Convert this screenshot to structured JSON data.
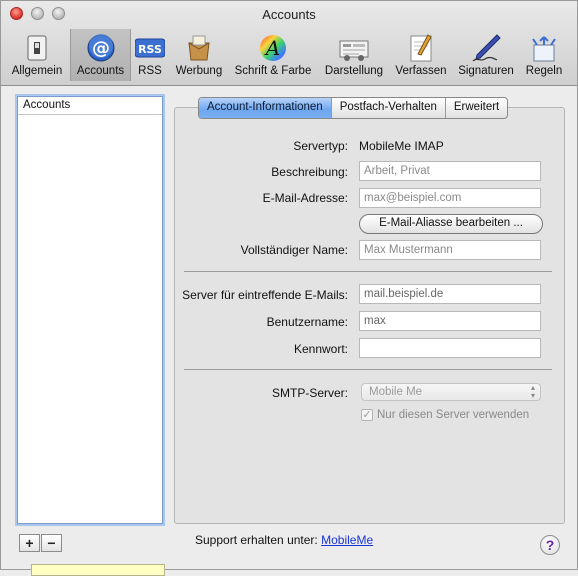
{
  "window": {
    "title": "Accounts"
  },
  "toolbar": {
    "items": [
      {
        "label": "Allgemein",
        "icon": "switch-icon"
      },
      {
        "label": "Accounts",
        "icon": "at-sign-icon"
      },
      {
        "label": "RSS",
        "icon": "rss-icon"
      },
      {
        "label": "Werbung",
        "icon": "junk-mail-icon"
      },
      {
        "label": "Schrift & Farbe",
        "icon": "font-color-icon"
      },
      {
        "label": "Darstellung",
        "icon": "viewing-icon"
      },
      {
        "label": "Verfassen",
        "icon": "compose-icon"
      },
      {
        "label": "Signaturen",
        "icon": "signature-pen-icon"
      },
      {
        "label": "Regeln",
        "icon": "rules-icon"
      }
    ],
    "selected": "Accounts",
    "rss_badge": "RSS"
  },
  "sidebar": {
    "header": "Accounts",
    "add": "+",
    "remove": "−"
  },
  "tabs": [
    {
      "label": "Account-Informationen",
      "active": true
    },
    {
      "label": "Postfach-Verhalten",
      "active": false
    },
    {
      "label": "Erweitert",
      "active": false
    }
  ],
  "form": {
    "servertype_label": "Servertyp:",
    "servertype_value": "MobileMe IMAP",
    "description_label": "Beschreibung:",
    "description_placeholder": "Arbeit, Privat",
    "email_label": "E-Mail-Adresse:",
    "email_placeholder": "max@beispiel.com",
    "alias_button": "E-Mail-Aliasse bearbeiten ...",
    "fullname_label": "Vollständiger Name:",
    "fullname_placeholder": "Max Mustermann",
    "incoming_label": "Server für eintreffende E-Mails:",
    "incoming_value": "mail.beispiel.de",
    "username_label": "Benutzername:",
    "username_value": "max",
    "password_label": "Kennwort:",
    "password_value": "",
    "smtp_label": "SMTP-Server:",
    "smtp_value": "Mobile Me",
    "only_server_label": "Nur diesen Server verwenden",
    "only_server_checked": true
  },
  "footer": {
    "support_text": "Support erhalten unter:",
    "support_link": "MobileMe",
    "help": "?"
  },
  "colors": {
    "accent_tab": "#6ea6ef",
    "link": "#1a35d6",
    "close": "#d8332a"
  }
}
